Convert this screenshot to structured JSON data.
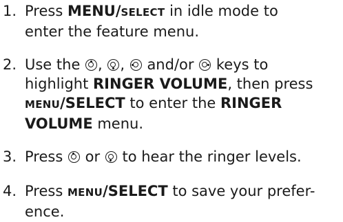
{
  "steps": [
    {
      "number": "1.",
      "line1_pre": "Press ",
      "menu_bold": "MENU/",
      "select_small": "SELECT",
      "line1_post": " in idle mode to",
      "line2": "enter the feature menu."
    },
    {
      "number": "2.",
      "line1_pre": "Use the ",
      "sep1": ", ",
      "sep2": ", ",
      "sep3": " and/or ",
      "line1_post": " keys to",
      "line2_pre": "highlight ",
      "ringer_volume": "RINGER VOLUME",
      "line2_post": ", then press",
      "menu_small": "MENU",
      "select_bold": "/SELECT",
      "line3_mid": " to enter the ",
      "ringer": "RINGER",
      "volume": "VOLUME",
      "line4_post": " menu."
    },
    {
      "number": "3.",
      "line1_pre": "Press ",
      "or": " or ",
      "line1_post": " to hear the ringer levels."
    },
    {
      "number": "4.",
      "line1_pre": "Press ",
      "menu_small": "MENU",
      "select_bold": "/SELECT",
      "line1_post": " to save your prefer-",
      "line2": "ence."
    }
  ],
  "icons": {
    "up": "up-key-icon",
    "down": "down-key-icon",
    "left": "left-key-icon",
    "right": "right-key-icon"
  }
}
